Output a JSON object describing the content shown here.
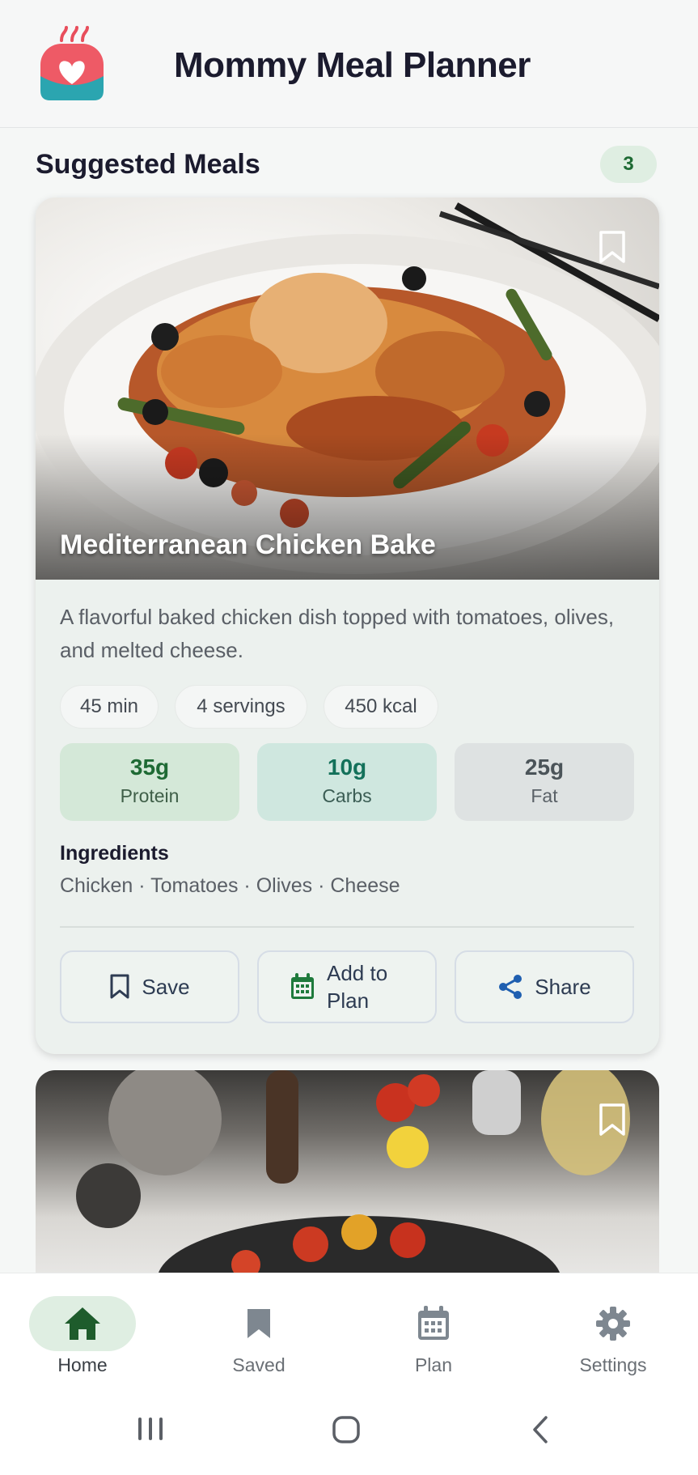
{
  "header": {
    "app_title": "Mommy Meal Planner",
    "logo_icon": "heart-bowl-logo-icon",
    "brand_color": "#e84e5c",
    "accent_color": "#1e6a34"
  },
  "section": {
    "title": "Suggested Meals",
    "count": "3"
  },
  "meals": [
    {
      "title": "Mediterranean Chicken Bake",
      "description": "A flavorful baked chicken dish topped with tomatoes, olives, and melted cheese.",
      "time": "45 min",
      "servings": "4 servings",
      "calories": "450 kcal",
      "macros": {
        "protein": {
          "value": "35g",
          "label": "Protein"
        },
        "carbs": {
          "value": "10g",
          "label": "Carbs"
        },
        "fat": {
          "value": "25g",
          "label": "Fat"
        }
      },
      "ingredients_heading": "Ingredients",
      "ingredients": "Chicken · Tomatoes · Olives · Cheese",
      "actions": {
        "save": "Save",
        "add_to_plan": "Add to Plan",
        "share": "Share"
      }
    }
  ],
  "nav": {
    "items": [
      {
        "label": "Home",
        "icon": "home-icon",
        "active": true
      },
      {
        "label": "Saved",
        "icon": "bookmark-icon",
        "active": false
      },
      {
        "label": "Plan",
        "icon": "calendar-icon",
        "active": false
      },
      {
        "label": "Settings",
        "icon": "gear-icon",
        "active": false
      }
    ]
  }
}
